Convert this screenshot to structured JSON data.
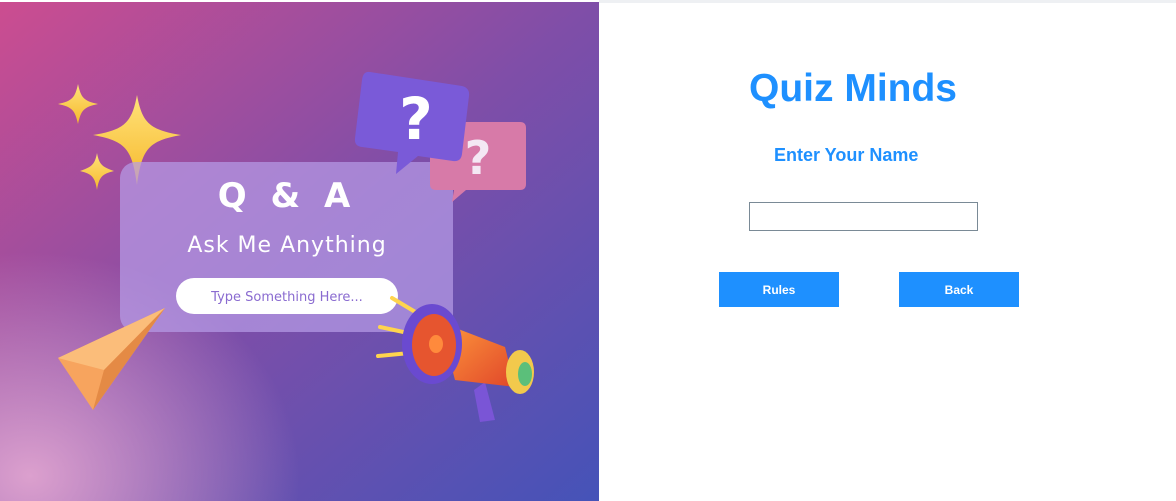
{
  "banner": {
    "heading": "Q & A",
    "subheading": "Ask Me Anything",
    "placeholder_text": "Type Something Here...",
    "question_mark": "?",
    "icons": [
      "sparkle-icon",
      "question-bubble-icon",
      "paper-plane-icon",
      "megaphone-icon"
    ]
  },
  "form": {
    "title": "Quiz Minds",
    "name_label": "Enter Your Name",
    "name_value": "",
    "rules_label": "Rules",
    "back_label": "Back"
  },
  "colors": {
    "accent": "#1e90ff",
    "banner_gradient_start": "#c84e94",
    "banner_gradient_end": "#4a55b8"
  }
}
